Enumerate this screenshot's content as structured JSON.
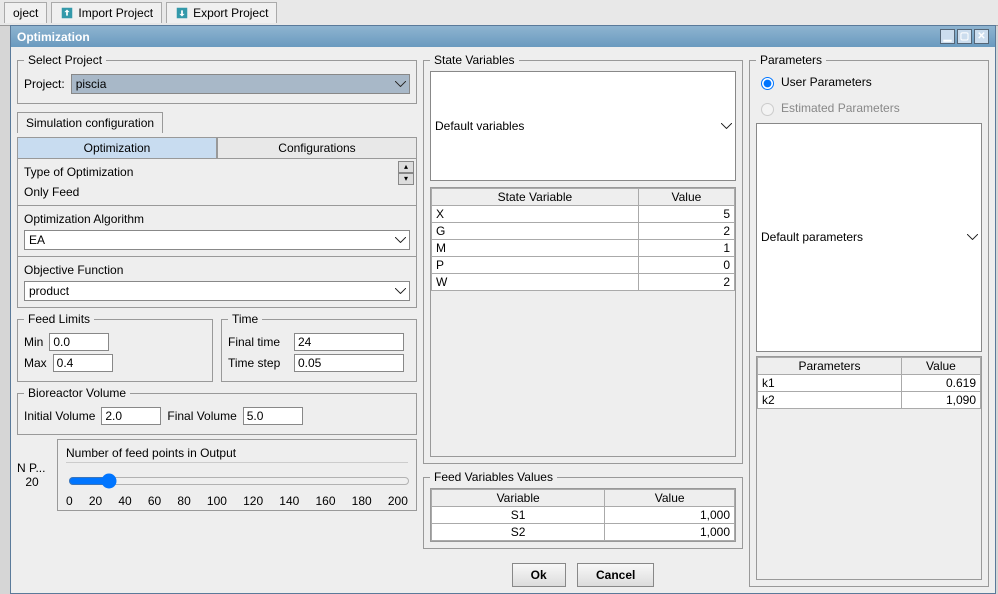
{
  "toolbar": {
    "tab0": "oject",
    "tab1": "Import Project",
    "tab2": "Export Project"
  },
  "window": {
    "title": "Optimization"
  },
  "selectProject": {
    "legend": "Select Project",
    "projectLabel": "Project:",
    "projectValue": "piscia"
  },
  "simConfig": {
    "stripLabel": "Simulation configuration",
    "tabOpt": "Optimization",
    "tabConf": "Configurations",
    "typeLabel": "Type of Optimization",
    "typeValue": "Only Feed",
    "algoLabel": "Optimization Algorithm",
    "algoValue": "EA",
    "objLabel": "Objective Function",
    "objValue": "product"
  },
  "feedLimits": {
    "legend": "Feed Limits",
    "minLabel": "Min",
    "minValue": "0.0",
    "maxLabel": "Max",
    "maxValue": "0.4"
  },
  "time": {
    "legend": "Time",
    "finalLabel": "Final time",
    "finalValue": "24",
    "stepLabel": "Time step",
    "stepValue": "0.05"
  },
  "bioreactor": {
    "legend": "Bioreactor Volume",
    "initLabel": "Initial Volume",
    "initValue": "2.0",
    "finalLabel": "Final Volume",
    "finalValue": "5.0"
  },
  "feedPoints": {
    "shortLabel": "N P...",
    "value": "20",
    "title": "Number of feed points in Output",
    "ticks": [
      "0",
      "20",
      "40",
      "60",
      "80",
      "100",
      "120",
      "140",
      "160",
      "180",
      "200"
    ]
  },
  "stateVars": {
    "legend": "State Variables",
    "combo": "Default variables",
    "colVar": "State Variable",
    "colVal": "Value",
    "rows": [
      {
        "v": "X",
        "n": "5"
      },
      {
        "v": "G",
        "n": "2"
      },
      {
        "v": "M",
        "n": "1"
      },
      {
        "v": "P",
        "n": "0"
      },
      {
        "v": "W",
        "n": "2"
      }
    ]
  },
  "feedVarVals": {
    "legend": "Feed Variables Values",
    "colVar": "Variable",
    "colVal": "Value",
    "rows": [
      {
        "v": "S1",
        "n": "1,000"
      },
      {
        "v": "S2",
        "n": "1,000"
      }
    ]
  },
  "params": {
    "legend": "Parameters",
    "radioUser": "User Parameters",
    "radioEst": "Estimated Parameters",
    "combo": "Default parameters",
    "colPar": "Parameters",
    "colVal": "Value",
    "rows": [
      {
        "p": "k1",
        "v": "0.619"
      },
      {
        "p": "k2",
        "v": "1,090"
      }
    ]
  },
  "buttons": {
    "ok": "Ok",
    "cancel": "Cancel"
  }
}
